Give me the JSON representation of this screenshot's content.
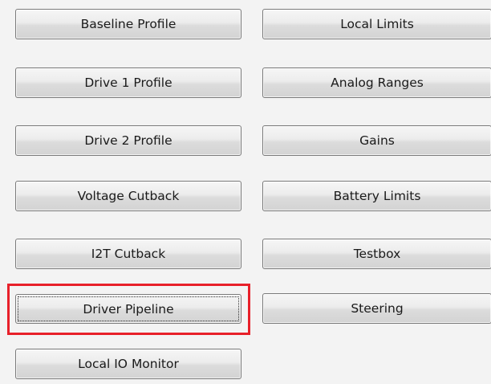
{
  "buttons": {
    "baseline_profile": "Baseline Profile",
    "local_limits": "Local Limits",
    "drive1_profile": "Drive 1 Profile",
    "analog_ranges": "Analog Ranges",
    "drive2_profile": "Drive 2 Profile",
    "gains": "Gains",
    "voltage_cutback": "Voltage Cutback",
    "battery_limits": "Battery Limits",
    "i2t_cutback": "I2T Cutback",
    "testbox": "Testbox",
    "driver_pipeline": "Driver Pipeline",
    "steering": "Steering",
    "local_io_monitor": "Local IO Monitor"
  },
  "colors": {
    "highlight": "#e8202a",
    "background": "#f3f3f3"
  }
}
